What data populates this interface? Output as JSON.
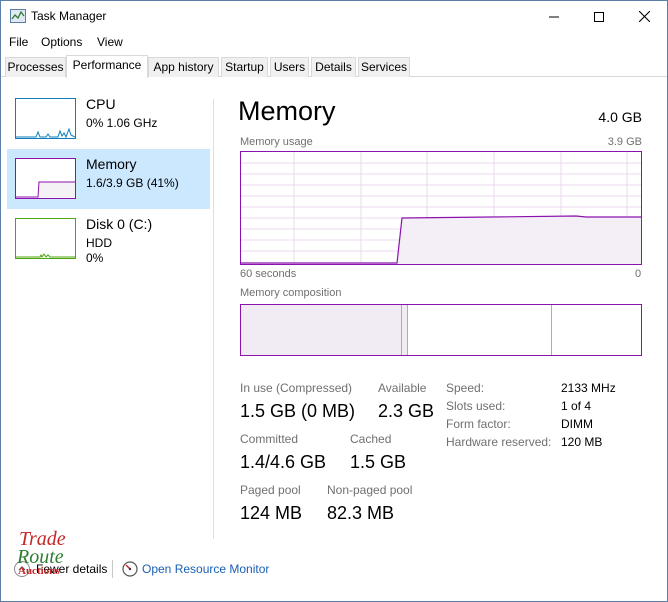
{
  "window": {
    "title": "Task Manager"
  },
  "menu": [
    "File",
    "Options",
    "View"
  ],
  "tabs": [
    "Processes",
    "Performance",
    "App history",
    "Startup",
    "Users",
    "Details",
    "Services"
  ],
  "sidebar": {
    "items": [
      {
        "name": "CPU",
        "detail1": "0%  1.06 GHz",
        "detail2": ""
      },
      {
        "name": "Memory",
        "detail1": "1.6/3.9 GB (41%)",
        "detail2": ""
      },
      {
        "name": "Disk 0 (C:)",
        "detail1": "HDD",
        "detail2": "0%"
      }
    ]
  },
  "main": {
    "title": "Memory",
    "total": "4.0 GB",
    "usage_label": "Memory usage",
    "usage_max": "3.9 GB",
    "time_left": "60 seconds",
    "time_right": "0",
    "composition_label": "Memory composition"
  },
  "stats": {
    "in_use_label": "In use (Compressed)",
    "in_use_value": "1.5 GB (0 MB)",
    "available_label": "Available",
    "available_value": "2.3 GB",
    "committed_label": "Committed",
    "committed_value": "1.4/4.6 GB",
    "cached_label": "Cached",
    "cached_value": "1.5 GB",
    "paged_label": "Paged pool",
    "paged_value": "124 MB",
    "nonpaged_label": "Non-paged pool",
    "nonpaged_value": "82.3 MB"
  },
  "specs": [
    {
      "label": "Speed:",
      "value": "2133 MHz"
    },
    {
      "label": "Slots used:",
      "value": "1 of 4"
    },
    {
      "label": "Form factor:",
      "value": "DIMM"
    },
    {
      "label": "Hardware reserved:",
      "value": "120 MB"
    }
  ],
  "footer": {
    "fewer_details": "Fewer details",
    "resource_monitor": "Open Resource Monitor"
  },
  "watermark": {
    "line1": "Trade",
    "line2": "Route",
    "line3": "Auctions"
  },
  "colors": {
    "memory_accent": "#8b12ae",
    "cpu_accent": "#117dbb",
    "disk_accent": "#4da60c",
    "selected_bg": "#cce8ff",
    "link": "#1a5fb4"
  },
  "memory_usage_percent": 41
}
